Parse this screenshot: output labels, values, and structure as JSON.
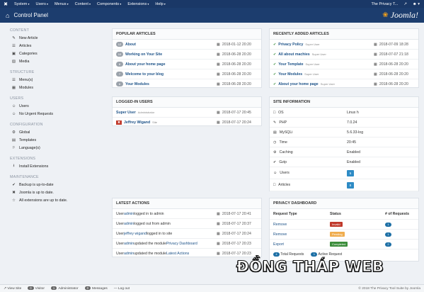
{
  "topnav": {
    "logo": "✖",
    "menu": [
      "System",
      "Users",
      "Menus",
      "Content",
      "Components",
      "Extensions",
      "Help"
    ],
    "site_link": "The Privacy T...",
    "user_icon": "user-icon"
  },
  "header": {
    "title": "Control Panel",
    "brand": "Joomla!"
  },
  "sidebar": {
    "sections": [
      {
        "title": "CONTENT",
        "items": [
          {
            "label": "New Article",
            "icon": "✎"
          },
          {
            "label": "Articles",
            "icon": "☰"
          },
          {
            "label": "Categories",
            "icon": "▣"
          },
          {
            "label": "Media",
            "icon": "▨"
          }
        ]
      },
      {
        "title": "STRUCTURE",
        "items": [
          {
            "label": "Menu(s)",
            "icon": "☰"
          },
          {
            "label": "Modules",
            "icon": "▦"
          }
        ]
      },
      {
        "title": "USERS",
        "items": [
          {
            "label": "Users",
            "icon": "☺"
          },
          {
            "label": "No Urgent Requests",
            "icon": "☺"
          }
        ]
      },
      {
        "title": "CONFIGURATION",
        "items": [
          {
            "label": "Global",
            "icon": "⚙"
          },
          {
            "label": "Templates",
            "icon": "▤"
          },
          {
            "label": "Language(s)",
            "icon": "⚐"
          }
        ]
      },
      {
        "title": "EXTENSIONS",
        "items": [
          {
            "label": "Install Extensions",
            "icon": "⭳"
          }
        ]
      },
      {
        "title": "MAINTENANCE",
        "items": [
          {
            "label": "Backup is up-to-date",
            "icon": "✔"
          },
          {
            "label": "Joomla is up to date.",
            "icon": "✖"
          },
          {
            "label": "All extensions are up to date.",
            "icon": "☆"
          }
        ]
      }
    ]
  },
  "popular": {
    "heading": "POPULAR ARTICLES",
    "rows": [
      {
        "count": "12",
        "title": "About",
        "date": "2018-01-12 20:20"
      },
      {
        "count": "10",
        "title": "Working on Your Site",
        "date": "2018-06-28 20:20"
      },
      {
        "count": "8",
        "title": "About your home page",
        "date": "2018-06-28 20:20"
      },
      {
        "count": "7",
        "title": "Welcome to your blog",
        "date": "2018-06-28 20:20"
      },
      {
        "count": "6",
        "title": "Your Modules",
        "date": "2018-06-28 20:20"
      }
    ]
  },
  "recent": {
    "heading": "RECENTLY ADDED ARTICLES",
    "rows": [
      {
        "title": "Privacy Policy",
        "author": "Super User",
        "date": "2018-07-09 18:28"
      },
      {
        "title": "All about machies",
        "author": "Super User",
        "date": "2018-07-07 21:18"
      },
      {
        "title": "Your Template",
        "author": "Super User",
        "date": "2018-06-28 20:20"
      },
      {
        "title": "Your Modules",
        "author": "Super User",
        "date": "2018-06-28 20:20"
      },
      {
        "title": "About your home page",
        "author": "Super User",
        "date": "2018-06-28 20:20"
      }
    ]
  },
  "logged": {
    "heading": "LOGGED-IN USERS",
    "rows": [
      {
        "name": "Super User",
        "role": "Administrator",
        "date": "2018-07-17 20:45",
        "logout": false
      },
      {
        "name": "Jeffrey Wigand",
        "role": "Site",
        "date": "2018-07-17 20:24",
        "logout": true
      }
    ]
  },
  "sysinfo": {
    "heading": "SITE INFORMATION",
    "rows": [
      {
        "label": "OS",
        "value": "Linux h",
        "icon": "□"
      },
      {
        "label": "PHP",
        "value": "7.0.24",
        "icon": "✎"
      },
      {
        "label": "MySQLi",
        "value": "5.6.33-log",
        "icon": "▤"
      },
      {
        "label": "Time",
        "value": "20:45",
        "icon": "◷"
      },
      {
        "label": "Caching",
        "value": "Enabled",
        "icon": "⚙"
      },
      {
        "label": "Gzip",
        "value": "Enabled",
        "icon": "✔"
      },
      {
        "label": "Users",
        "value": "5",
        "icon": "☺",
        "badge": true
      },
      {
        "label": "Articles",
        "value": "8",
        "icon": "□",
        "badge": true
      }
    ]
  },
  "actions": {
    "heading": "LATEST ACTIONS",
    "rows": [
      {
        "pre": "User ",
        "who": "admin",
        "post": " logged in to admin",
        "date": "2018-07-17 20:41"
      },
      {
        "pre": "User ",
        "who": "admin",
        "post": " logged out from admin",
        "date": "2018-07-17 20:37"
      },
      {
        "pre": "User ",
        "who": "jeffrey wigand",
        "post": " logged in to site",
        "date": "2018-07-17 20:24"
      },
      {
        "pre": "User ",
        "who": "admin",
        "post": " updated the module ",
        "target": "Privacy Dashboard",
        "date": "2018-07-17 20:23"
      },
      {
        "pre": "User ",
        "who": "admin",
        "post": " updated the module ",
        "target": "Latest Actions",
        "date": "2018-07-17 20:23"
      }
    ]
  },
  "privacy": {
    "heading": "PRIVACY DASHBOARD",
    "cols": [
      "Request Type",
      "Status",
      "# of Requests"
    ],
    "rows": [
      {
        "type": "Remove",
        "status": "Invalid",
        "color": "#c0392b",
        "count": "1"
      },
      {
        "type": "Remove",
        "status": "Pending",
        "color": "#f0ad4e",
        "count": "1"
      },
      {
        "type": "Export",
        "status": "Completed",
        "color": "#3b8d3b",
        "count": "2"
      }
    ],
    "legend": [
      {
        "count": "4",
        "label": "Total Requests"
      },
      {
        "count": "1",
        "label": "Active Request"
      }
    ]
  },
  "footer": {
    "view_site": "View Site",
    "visitor_count": "0",
    "visitor": "Visitor",
    "admin_count": "1",
    "admin": "Administrator",
    "messages_count": "0",
    "messages": "Messages",
    "logout": "Log out",
    "copyright": "© 2018 The Privacy Tool Suite by Joomla"
  },
  "watermark": "ĐỒNG THÁP WEB"
}
